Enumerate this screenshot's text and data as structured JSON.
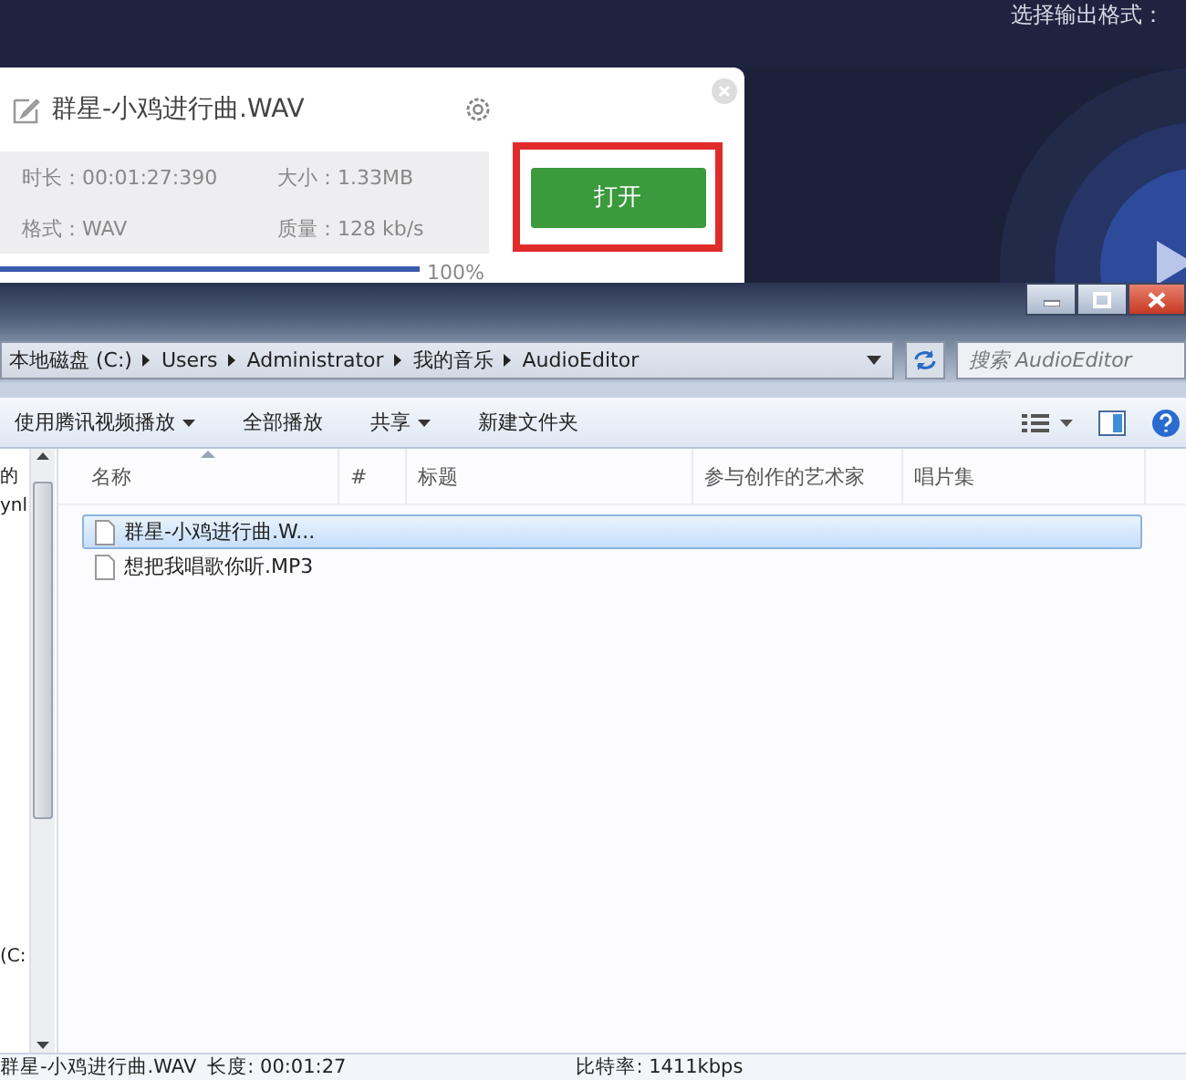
{
  "app": {
    "header_label": "选择输出格式：",
    "file_card": {
      "title": "群星-小鸡进行曲.WAV",
      "details": [
        "时长：00:01:27:390",
        "大小：1.33MB",
        "格式：WAV",
        "质量：128 kb/s"
      ],
      "progress": {
        "level": 1,
        "reading": "100%"
      },
      "open_button": "打开",
      "highlighted": true
    }
  },
  "explorer": {
    "address": [
      "本地磁盘 (C:)",
      "Users",
      "Administrator",
      "我的音乐",
      "AudioEditor"
    ],
    "search": {
      "placeholder": "搜索 AudioEditor"
    },
    "toolbar": [
      {
        "label": "使用腾讯视频播放",
        "dropdown": true
      },
      {
        "label": "全部播放",
        "dropdown": false
      },
      {
        "label": "共享",
        "dropdown": true
      },
      {
        "label": "新建文件夹",
        "dropdown": false
      }
    ],
    "nav_pane": [
      "的",
      "ynl",
      "(C:"
    ],
    "columns": [
      "名称",
      "#",
      "标题",
      "参与创作的艺术家",
      "唱片集"
    ],
    "files": [
      {
        "name": "群星-小鸡进行曲.W...",
        "selected": true
      },
      {
        "name": "想把我唱歌你听.MP3",
        "selected": false
      }
    ],
    "status_bar": {
      "file": "群星-小鸡进行曲.WAV",
      "length": "长度: 00:01:27",
      "bitrate": "比特率: 1411kbps"
    }
  }
}
